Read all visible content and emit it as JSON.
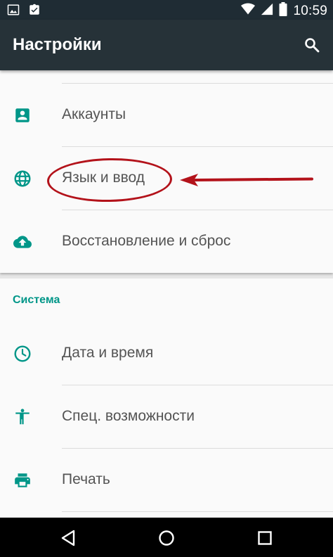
{
  "status_bar": {
    "time": "10:59",
    "left_icons": [
      "image-icon",
      "clipboard-check-icon"
    ],
    "right_icons": [
      "wifi-icon",
      "signal-icon",
      "battery-icon"
    ]
  },
  "app_bar": {
    "title": "Настройки",
    "search_icon": "search-icon"
  },
  "personal_items": [
    {
      "label": "Аккаунты",
      "icon": "account-box-icon"
    },
    {
      "label": "Язык и ввод",
      "icon": "globe-icon"
    },
    {
      "label": "Восстановление и сброс",
      "icon": "cloud-upload-icon"
    }
  ],
  "system_section": {
    "header": "Система",
    "items": [
      {
        "label": "Дата и время",
        "icon": "clock-icon"
      },
      {
        "label": "Спец. возможности",
        "icon": "accessibility-icon"
      },
      {
        "label": "Печать",
        "icon": "printer-icon"
      }
    ]
  },
  "nav_bar": {
    "buttons": [
      "back-icon",
      "home-icon",
      "recents-icon"
    ]
  },
  "colors": {
    "app_bar": "#263238",
    "status_bar": "#1f2c34",
    "accent": "#009688",
    "annotation": "#b3121a",
    "background": "#fafafa"
  }
}
